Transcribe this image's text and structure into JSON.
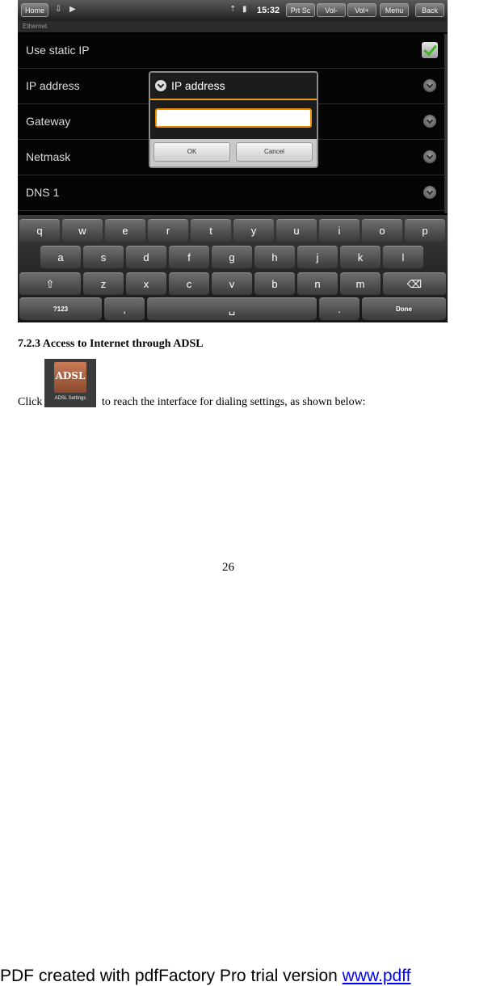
{
  "screenshot": {
    "statusbar": {
      "home": "Home",
      "clock": "15:32",
      "buttons": [
        "Prt Sc",
        "Vol-",
        "Vol+",
        "Menu",
        "Back"
      ]
    },
    "section_header": "Ethernet",
    "settings": [
      {
        "label": "Use static IP",
        "control": "checkbox",
        "checked": true
      },
      {
        "label": "IP address",
        "control": "arrow"
      },
      {
        "label": "Gateway",
        "control": "arrow"
      },
      {
        "label": "Netmask",
        "control": "arrow"
      },
      {
        "label": "DNS 1",
        "control": "arrow"
      }
    ],
    "dialog": {
      "title": "IP address",
      "value": "",
      "ok": "OK",
      "cancel": "Cancel"
    },
    "keyboard": {
      "row1": [
        "q",
        "w",
        "e",
        "r",
        "t",
        "y",
        "u",
        "i",
        "o",
        "p"
      ],
      "row2": [
        "a",
        "s",
        "d",
        "f",
        "g",
        "h",
        "j",
        "k",
        "l"
      ],
      "row3": [
        "z",
        "x",
        "c",
        "v",
        "b",
        "n",
        "m"
      ],
      "symbols": "?123",
      "comma": ",",
      "space": "␣",
      "period": ".",
      "done": "Done"
    }
  },
  "document": {
    "heading": "7.2.3 Access to Internet through ADSL",
    "click_word": "Click",
    "icon_caption": "ADSL Settings",
    "icon_tile_text": "ADSL",
    "after_icon": "to reach the interface for dialing settings, as shown below:",
    "page_number": "26"
  },
  "footer": {
    "text": "PDF created with pdfFactory Pro trial version ",
    "link": "www.pdff"
  }
}
